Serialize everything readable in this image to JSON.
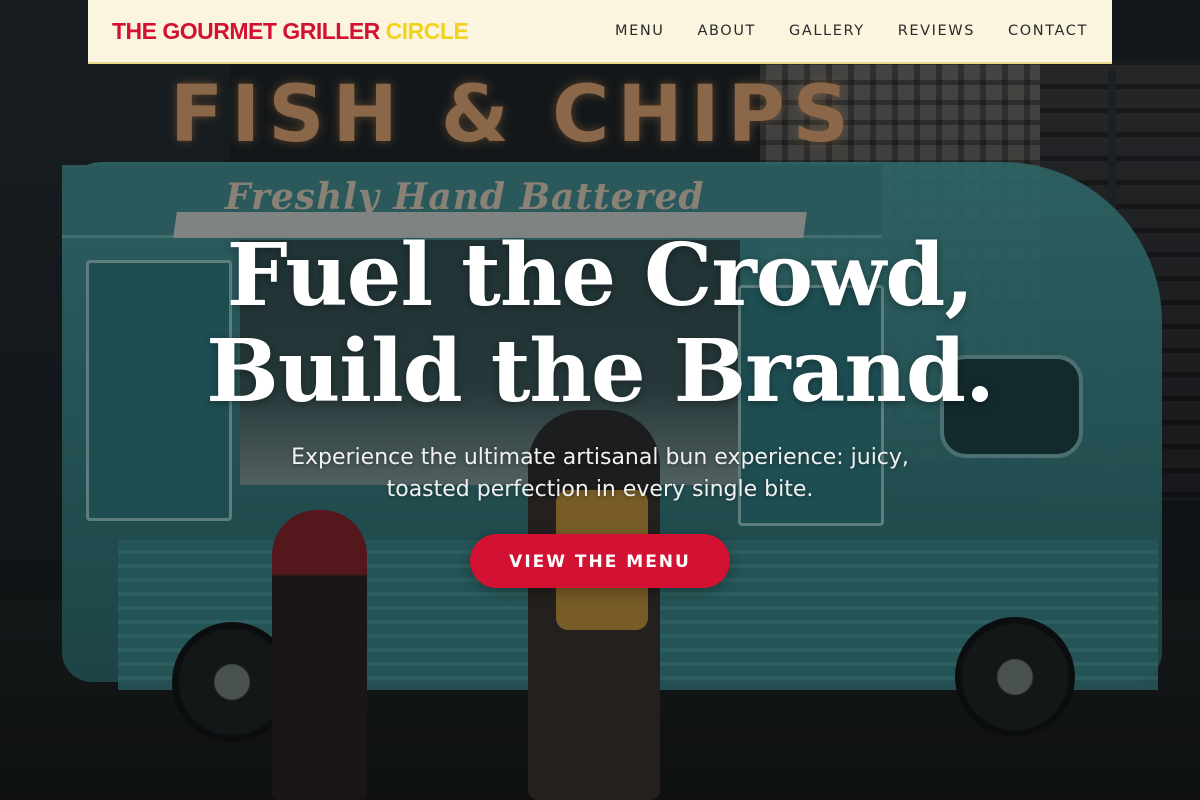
{
  "header": {
    "brand_main": "THE GOURMET GRILLER",
    "brand_accent": "CIRCLE",
    "nav": [
      {
        "label": "MENU"
      },
      {
        "label": "ABOUT"
      },
      {
        "label": "GALLERY"
      },
      {
        "label": "REVIEWS"
      },
      {
        "label": "CONTACT"
      }
    ]
  },
  "hero": {
    "headline_line1": "Fuel the Crowd,",
    "headline_line2": "Build the Brand.",
    "subtitle": "Experience the ultimate artisanal bun experience: juicy, toasted perfection in every single bite.",
    "cta_label": "VIEW THE MENU",
    "photo_sign_text": "FISH & CHIPS",
    "photo_truck_text": "Freshly Hand Battered"
  },
  "colors": {
    "brand_red": "#d31233",
    "brand_yellow": "#f2d31b",
    "nav_background": "#fbf5df",
    "truck_teal": "#4aa3a5"
  }
}
